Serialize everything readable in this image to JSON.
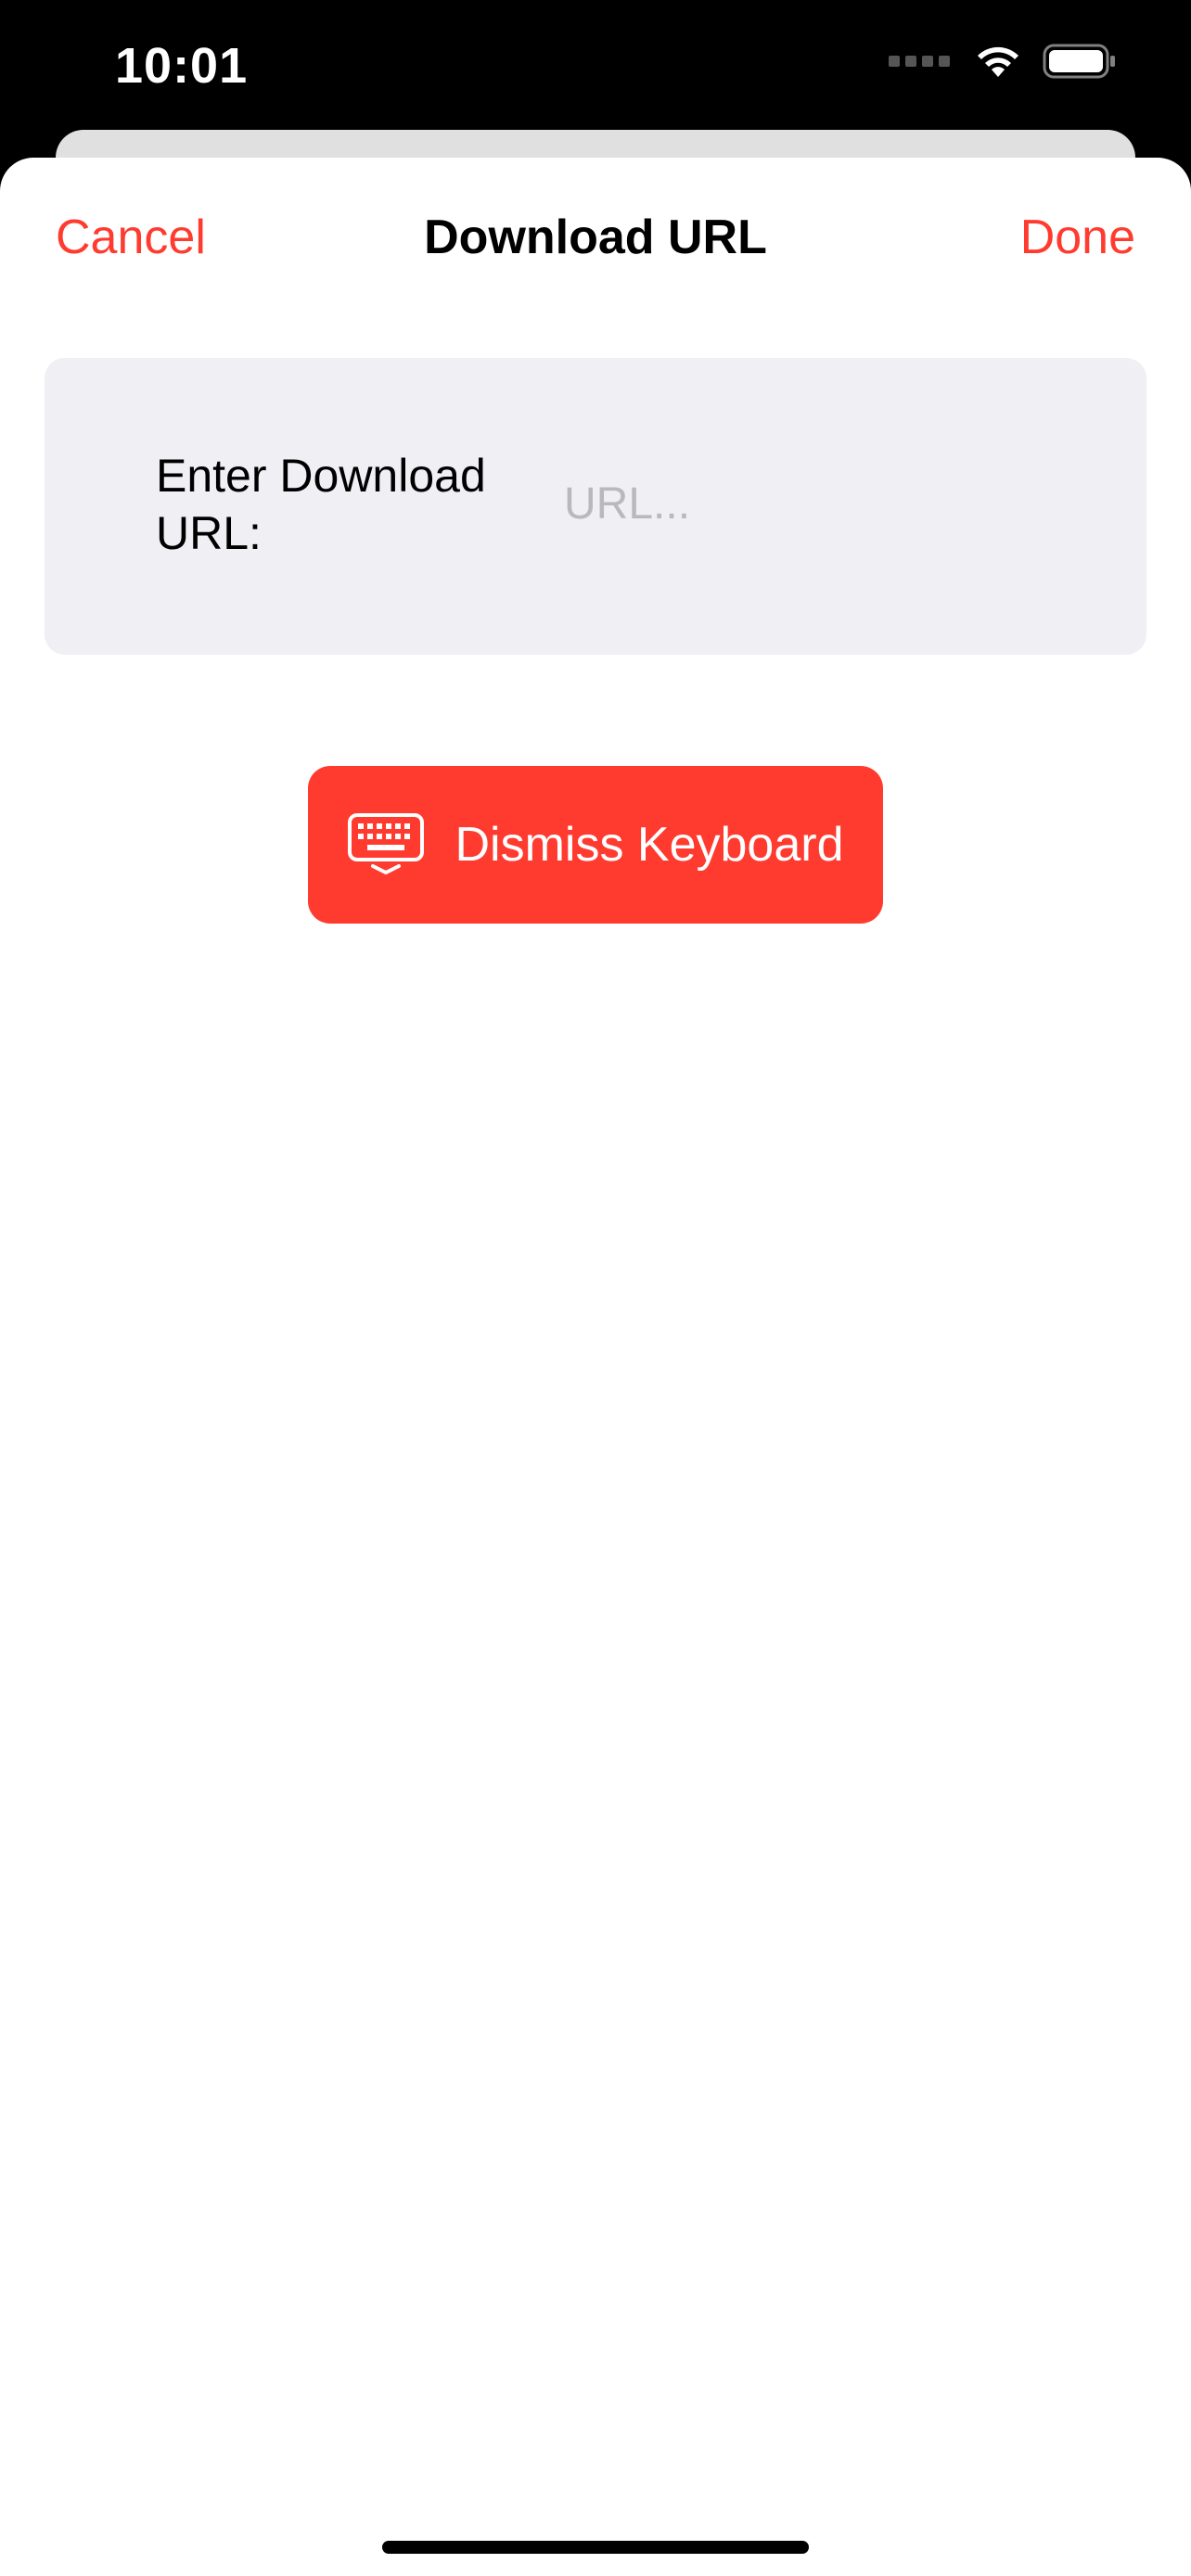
{
  "status_bar": {
    "time": "10:01",
    "icons": [
      "signal-icon",
      "wifi-icon",
      "battery-icon"
    ]
  },
  "nav": {
    "cancel_label": "Cancel",
    "title": "Download URL",
    "done_label": "Done"
  },
  "form": {
    "label": "Enter Download URL:",
    "url_value": "",
    "url_placeholder": "URL..."
  },
  "dismiss_button": {
    "label": "Dismiss Keyboard",
    "icon": "keyboard-icon"
  },
  "colors": {
    "accent": "#ff3b30",
    "card_background": "#efeff4",
    "placeholder": "#b8b8bd"
  }
}
